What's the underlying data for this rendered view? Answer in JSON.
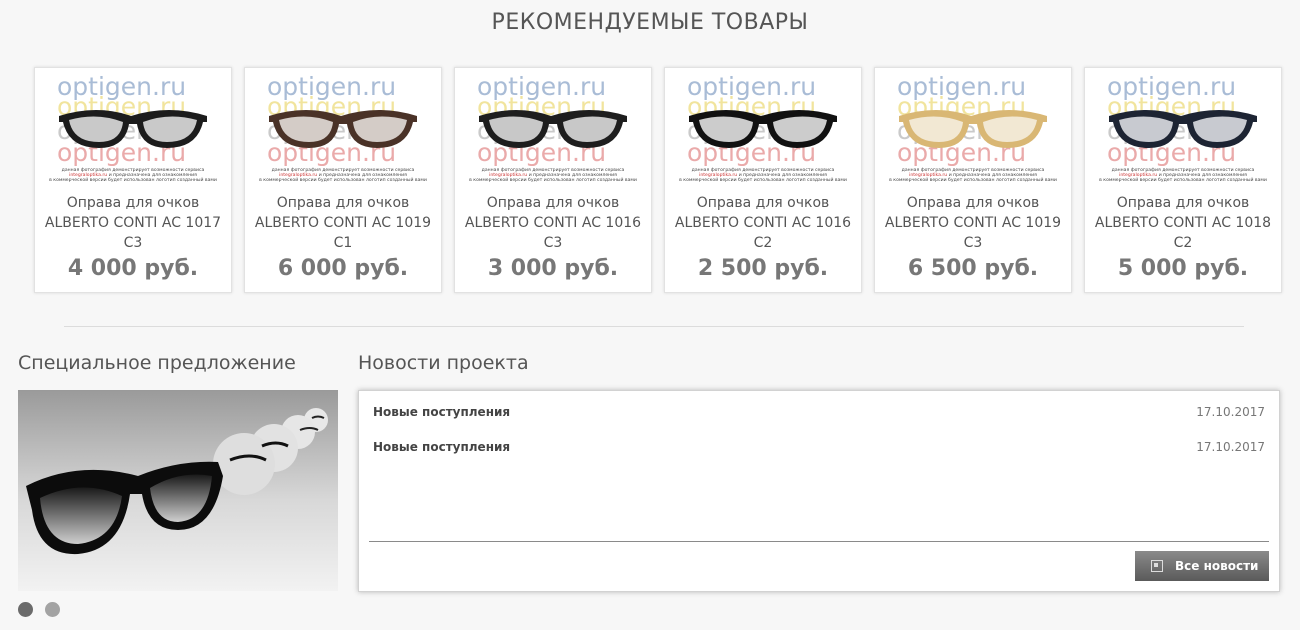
{
  "section": {
    "title": "РЕКОМЕНДУЕМЫЕ ТОВАРЫ"
  },
  "watermark": {
    "text": "optigen.ru",
    "line1": "данная фотография демонстрирует возможности сервиса",
    "link": "integralоptika.ru",
    "line2": "и предназначена для ознакомления",
    "line3": "в коммерческой версии будет использован логотип созданный вами"
  },
  "products": [
    {
      "name": "Оправа для очков ALBERTO CONTI AC 1017 C3",
      "price": "4 000 руб.",
      "frame_color": "#1c1c1c",
      "lens": "#e8e8e8"
    },
    {
      "name": "Оправа для очков ALBERTO CONTI AC 1019 C1",
      "price": "6 000 руб.",
      "frame_color": "#4a3227",
      "lens": "#ece8e4"
    },
    {
      "name": "Оправа для очков ALBERTO CONTI AC 1016 C3",
      "price": "3 000 руб.",
      "frame_color": "#1e1e1e",
      "lens": "#e6e6e6"
    },
    {
      "name": "Оправа для очков ALBERTO CONTI AC 1016 C2",
      "price": "2 500 руб.",
      "frame_color": "#111111",
      "lens": "#ededed"
    },
    {
      "name": "Оправа для очков ALBERTO CONTI AC 1019 C3",
      "price": "6 500 руб.",
      "frame_color": "#d9b774",
      "lens": "#f6f1e4"
    },
    {
      "name": "Оправа для очков ALBERTO CONTI AC 1018 C2",
      "price": "5 000 руб.",
      "frame_color": "#1d2433",
      "lens": "#e6e8ec"
    }
  ],
  "special": {
    "title": "Специальное предложение"
  },
  "news": {
    "title": "Новости проекта",
    "items": [
      {
        "title": "Новые поступления",
        "date": "17.10.2017"
      },
      {
        "title": "Новые поступления",
        "date": "17.10.2017"
      }
    ],
    "all_label": "Все новости"
  }
}
